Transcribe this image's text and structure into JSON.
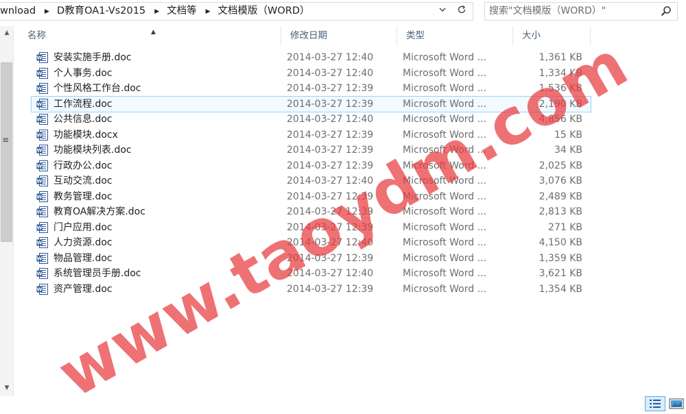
{
  "address_bar": {
    "breadcrumbs": [
      "wnload",
      "D教育OA1-Vs2015",
      "文档等",
      "文档模版（WORD）"
    ],
    "separator_icon": "chevron-right-icon",
    "dropdown_icon": "chevron-down-icon",
    "refresh_icon": "refresh-icon"
  },
  "search": {
    "placeholder": "搜索\"文档模版（WORD）\"",
    "icon": "search-icon"
  },
  "columns": {
    "name": "名称",
    "modified": "修改日期",
    "type": "类型",
    "size": "大小"
  },
  "files": [
    {
      "name": "安装实施手册.doc",
      "modified": "2014-03-27 12:40",
      "type": "Microsoft Word ...",
      "size": "1,361 KB"
    },
    {
      "name": "个人事务.doc",
      "modified": "2014-03-27 12:40",
      "type": "Microsoft Word ...",
      "size": "1,334 KB"
    },
    {
      "name": "个性风格工作台.doc",
      "modified": "2014-03-27 12:39",
      "type": "Microsoft Word ...",
      "size": "1,536 KB"
    },
    {
      "name": "工作流程.doc",
      "modified": "2014-03-27 12:39",
      "type": "Microsoft Word ...",
      "size": "2,190 KB"
    },
    {
      "name": "公共信息.doc",
      "modified": "2014-03-27 12:40",
      "type": "Microsoft Word ...",
      "size": "4,856 KB"
    },
    {
      "name": "功能模块.docx",
      "modified": "2014-03-27 12:39",
      "type": "Microsoft Word ...",
      "size": "15 KB"
    },
    {
      "name": "功能模块列表.doc",
      "modified": "2014-03-27 12:39",
      "type": "Microsoft Word ...",
      "size": "34 KB"
    },
    {
      "name": "行政办公.doc",
      "modified": "2014-03-27 12:39",
      "type": "Microsoft Word ...",
      "size": "2,025 KB"
    },
    {
      "name": "互动交流.doc",
      "modified": "2014-03-27 12:40",
      "type": "Microsoft Word ...",
      "size": "3,076 KB"
    },
    {
      "name": "教务管理.doc",
      "modified": "2014-03-27 12:39",
      "type": "Microsoft Word ...",
      "size": "2,489 KB"
    },
    {
      "name": "教育OA解决方案.doc",
      "modified": "2014-03-27 12:39",
      "type": "Microsoft Word ...",
      "size": "2,813 KB"
    },
    {
      "name": "门户应用.doc",
      "modified": "2014-03-27 12:39",
      "type": "Microsoft Word ...",
      "size": "271 KB"
    },
    {
      "name": "人力资源.doc",
      "modified": "2014-03-27 12:40",
      "type": "Microsoft Word ...",
      "size": "4,150 KB"
    },
    {
      "name": "物品管理.doc",
      "modified": "2014-03-27 12:39",
      "type": "Microsoft Word ...",
      "size": "1,359 KB"
    },
    {
      "name": "系统管理员手册.doc",
      "modified": "2014-03-27 12:40",
      "type": "Microsoft Word ...",
      "size": "3,621 KB"
    },
    {
      "name": "资产管理.doc",
      "modified": "2014-03-27 12:39",
      "type": "Microsoft Word ...",
      "size": "1,354 KB"
    }
  ],
  "selected_index": 3,
  "file_icon": "word-document-icon",
  "view_buttons": {
    "details": "details-view-icon",
    "tiles": "large-icons-view-icon"
  },
  "watermark": "www.taoydm.com",
  "colors": {
    "watermark": "#e83a3e",
    "selection_border": "#99d1ff",
    "header_text": "#4c607a"
  }
}
